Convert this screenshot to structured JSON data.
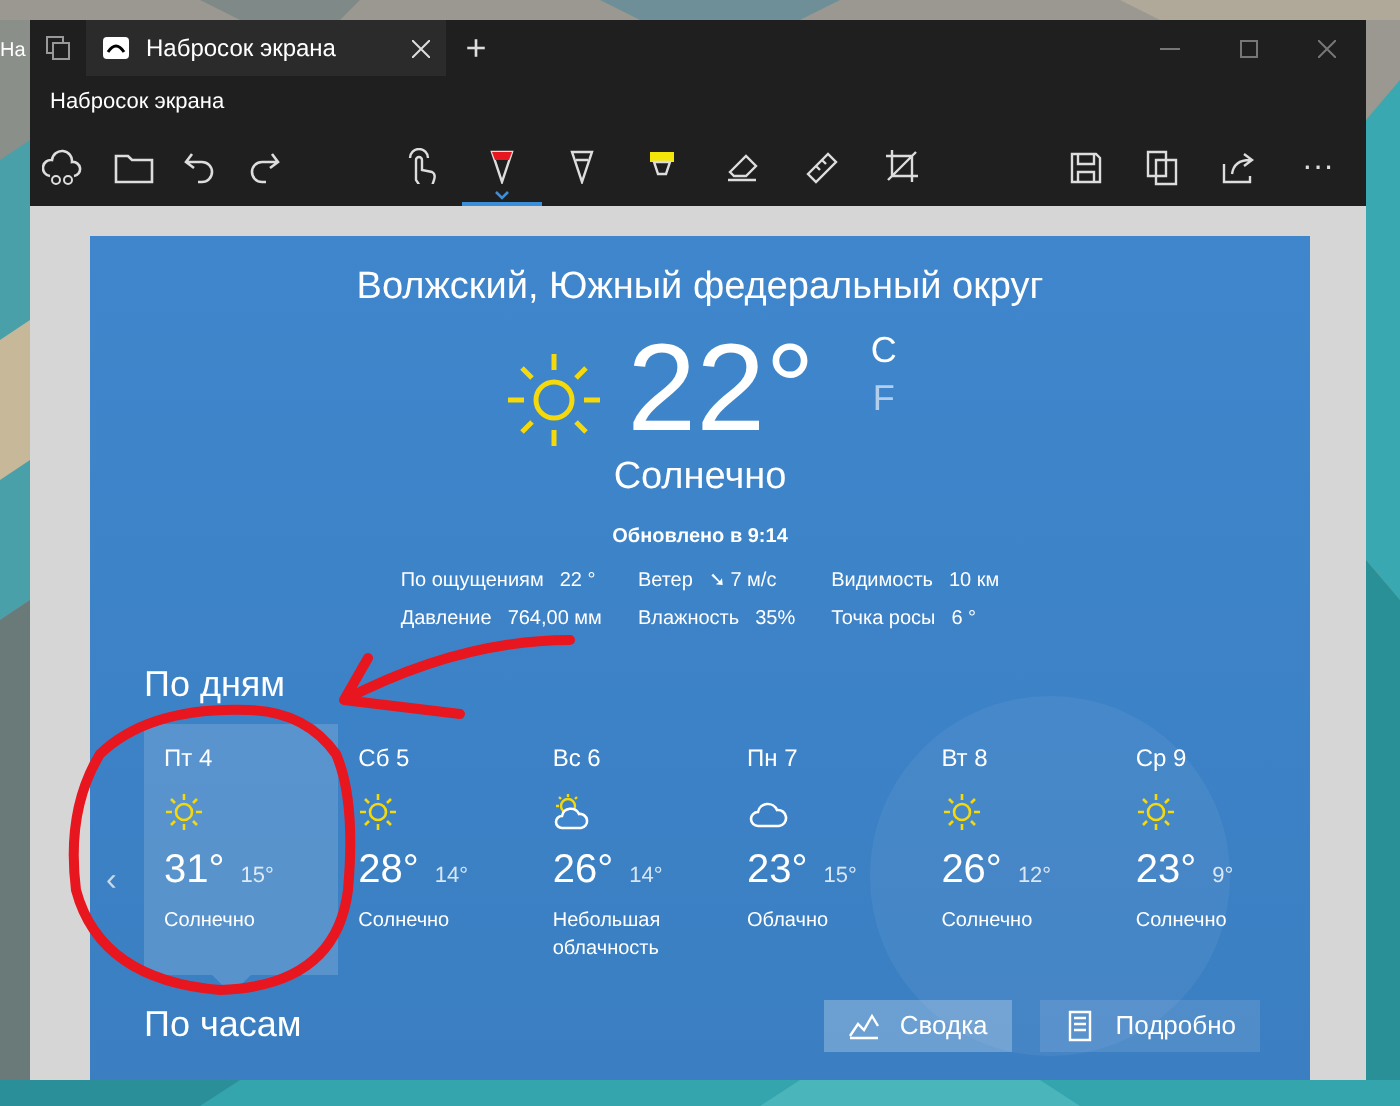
{
  "desktop": {
    "label": "На"
  },
  "window": {
    "tab_title": "Набросок экрана",
    "new_tab": "+",
    "title": "Набросок экрана"
  },
  "toolbar": {
    "tools": [
      {
        "kind": "touch",
        "selected": false
      },
      {
        "kind": "pen",
        "selected": true
      },
      {
        "kind": "pencil",
        "selected": false
      },
      {
        "kind": "highlighter",
        "selected": false
      },
      {
        "kind": "eraser",
        "selected": false
      },
      {
        "kind": "ruler",
        "selected": false
      },
      {
        "kind": "crop",
        "selected": false
      }
    ],
    "more": "···"
  },
  "weather": {
    "location": "Волжский, Южный федеральный округ",
    "temperature": "22°",
    "units": [
      {
        "label": "C",
        "selected": true
      },
      {
        "label": "F",
        "selected": false
      }
    ],
    "condition": "Солнечно",
    "updated": "Обновлено в 9:14",
    "details": [
      {
        "label": "По ощущениям",
        "value": "22 °"
      },
      {
        "label": "Ветер",
        "value": "➘ 7 м/с"
      },
      {
        "label": "Видимость",
        "value": "10 км"
      },
      {
        "label": "Давление",
        "value": "764,00 мм"
      },
      {
        "label": "Влажность",
        "value": "35%"
      },
      {
        "label": "Точка росы",
        "value": "6 °"
      }
    ],
    "daily_heading": "По дням",
    "prev": "‹",
    "days": [
      {
        "day": "Пт 4",
        "kind": "sunny",
        "high": "31°",
        "low": "15°",
        "condition": "Солнечно",
        "selected": true
      },
      {
        "day": "Сб 5",
        "kind": "sunny",
        "high": "28°",
        "low": "14°",
        "condition": "Солнечно",
        "selected": false
      },
      {
        "day": "Вс 6",
        "kind": "partly_cloudy",
        "high": "26°",
        "low": "14°",
        "condition": "Небольшая облачность",
        "selected": false
      },
      {
        "day": "Пн 7",
        "kind": "cloudy",
        "high": "23°",
        "low": "15°",
        "condition": "Облачно",
        "selected": false
      },
      {
        "day": "Вт 8",
        "kind": "sunny",
        "high": "26°",
        "low": "12°",
        "condition": "Солнечно",
        "selected": false
      },
      {
        "day": "Ср 9",
        "kind": "sunny",
        "high": "23°",
        "low": "9°",
        "condition": "Солнечно",
        "selected": false
      }
    ],
    "hourly_heading": "По часам",
    "views": [
      {
        "label": "Сводка",
        "kind": "summary",
        "selected": true
      },
      {
        "label": "Подробно",
        "kind": "details",
        "selected": false
      }
    ]
  }
}
